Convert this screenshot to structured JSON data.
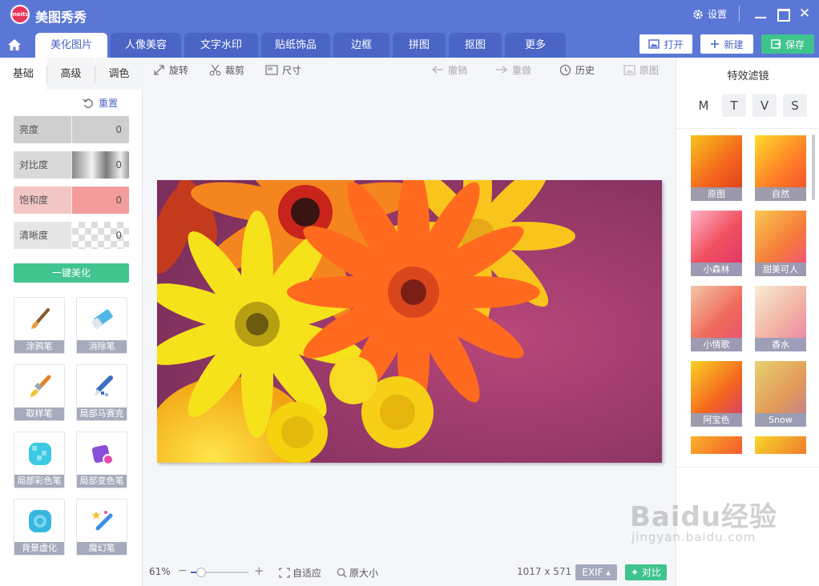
{
  "app": {
    "title": "美图秀秀",
    "logo_text": "meitu"
  },
  "window": {
    "settings_label": "设置"
  },
  "tabs": [
    {
      "label": "美化图片",
      "active": true
    },
    {
      "label": "人像美容"
    },
    {
      "label": "文字水印"
    },
    {
      "label": "贴纸饰品"
    },
    {
      "label": "边框"
    },
    {
      "label": "拼图"
    },
    {
      "label": "抠图"
    },
    {
      "label": "更多"
    }
  ],
  "actions": {
    "open": "打开",
    "new": "新建",
    "save": "保存"
  },
  "left_panel": {
    "subtabs": [
      "基础",
      "高级",
      "调色"
    ],
    "reset": "重置",
    "sliders": [
      {
        "label": "亮度",
        "value": "0"
      },
      {
        "label": "对比度",
        "value": "0"
      },
      {
        "label": "饱和度",
        "value": "0"
      },
      {
        "label": "清晰度",
        "value": "0"
      }
    ],
    "one_click": "一键美化",
    "tools": [
      {
        "label": "涂鸦笔",
        "icon": "paintbrush-icon"
      },
      {
        "label": "消除笔",
        "icon": "eraser-icon"
      },
      {
        "label": "取样笔",
        "icon": "sample-brush-icon"
      },
      {
        "label": "局部马赛克",
        "icon": "mosaic-pen-icon"
      },
      {
        "label": "局部彩色笔",
        "icon": "color-pen-icon"
      },
      {
        "label": "局部变色笔",
        "icon": "recolor-pen-icon"
      },
      {
        "label": "背景虚化",
        "icon": "blur-background-icon"
      },
      {
        "label": "魔幻笔",
        "icon": "magic-pen-icon"
      }
    ]
  },
  "toolbar": {
    "rotate": "旋转",
    "crop": "裁剪",
    "size": "尺寸",
    "undo": "撤销",
    "redo": "重做",
    "history": "历史",
    "original": "原图"
  },
  "right_panel": {
    "title": "特效滤镜",
    "categories": [
      "M",
      "T",
      "V",
      "S"
    ],
    "filters": [
      "原图",
      "自然",
      "小森林",
      "甜美可人",
      "小情歌",
      "香水",
      "阿宝色",
      "Snow"
    ]
  },
  "status": {
    "zoom": "61%",
    "fit": "自适应",
    "actual_size": "原大小",
    "dimensions": "1017 x 571",
    "exif": "EXIF",
    "compare": "对比"
  },
  "watermark": {
    "brand": "Baidu经验",
    "url": "jingyan.baidu.com"
  },
  "colors": {
    "brand_blue": "#5b77d6",
    "accent_green": "#3ec48c",
    "tool_label": "#a5abbb"
  }
}
